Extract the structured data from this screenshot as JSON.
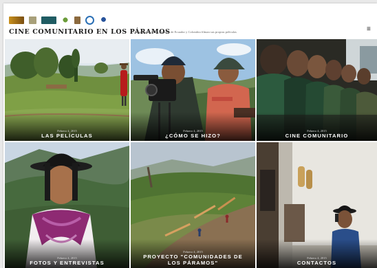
{
  "header": {
    "title": "CINE COMUNITARIO EN LOS PÁRAMOS",
    "tagline": "Comunidades de los páramos de Ecuador y Colombia filman sus propias películas",
    "menu_icon": "hamburger-menu-icon"
  },
  "tiles": [
    {
      "date": "Febrero 4, 2015",
      "label": "LAS PELÍCULAS"
    },
    {
      "date": "Febrero 4, 2015",
      "label": "¿CÓMO SE HIZO?"
    },
    {
      "date": "Febrero 4, 2015",
      "label": "CINE COMUNITARIO"
    },
    {
      "date": "Febrero 4, 2015",
      "label": "FOTOS Y ENTREVISTAS"
    },
    {
      "date": "Febrero 4, 2015",
      "label": "PROYECTO \"COMUNIDADES DE LOS PÁRAMOS\""
    },
    {
      "date": "Febrero 4, 2015",
      "label": "CONTACTOS"
    }
  ]
}
